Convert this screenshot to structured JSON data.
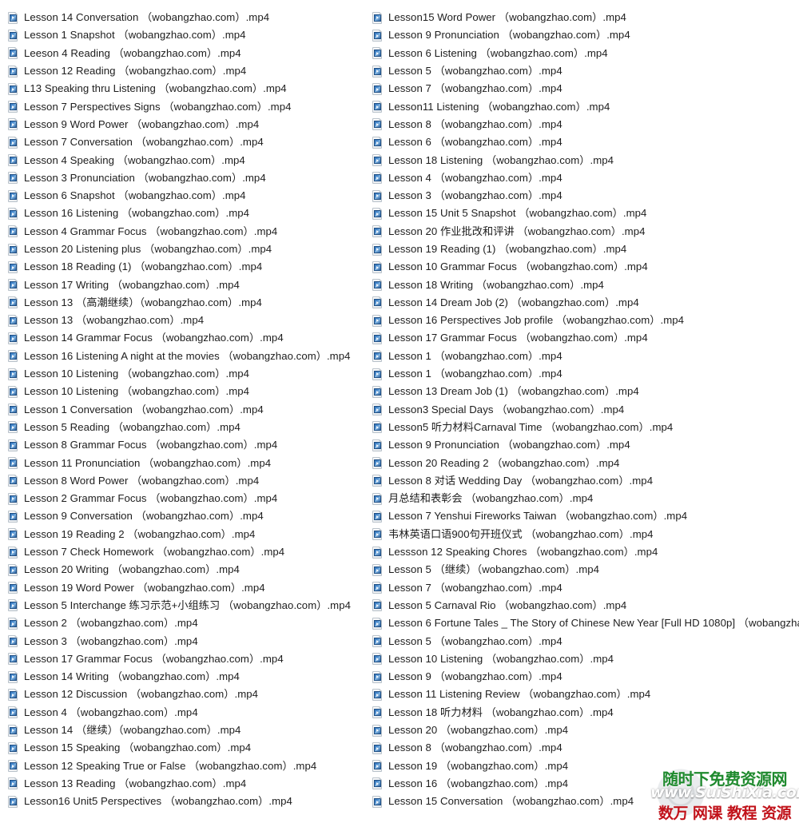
{
  "window": {
    "view": "file-list",
    "icon_type": "mp4-video-file-icon",
    "columns": 2,
    "background_color": "#ffffff",
    "text_color": "#1d1d1d"
  },
  "columns": {
    "left": {
      "files": [
        "Lesson 14 Conversation （wobangzhao.com）.mp4",
        "Lesson 1 Snapshot （wobangzhao.com）.mp4",
        "Leeson 4 Reading （wobangzhao.com）.mp4",
        "Lesson 12 Reading （wobangzhao.com）.mp4",
        "L13 Speaking thru Listening （wobangzhao.com）.mp4",
        "Lesson 7 Perspectives Signs （wobangzhao.com）.mp4",
        "Lesson 9 Word Power （wobangzhao.com）.mp4",
        "Lesson 7 Conversation （wobangzhao.com）.mp4",
        "Lesson 4 Speaking （wobangzhao.com）.mp4",
        "Lesson 3 Pronunciation （wobangzhao.com）.mp4",
        "Lesson 6 Snapshot （wobangzhao.com）.mp4",
        "Lesson 16 Listening （wobangzhao.com）.mp4",
        "Lesson 4 Grammar Focus （wobangzhao.com）.mp4",
        "Lesson 20 Listening plus （wobangzhao.com）.mp4",
        "Lesson 18 Reading (1) （wobangzhao.com）.mp4",
        "Lesson 17 Writing （wobangzhao.com）.mp4",
        "Lesson 13 （高潮继续）（wobangzhao.com）.mp4",
        "Lesson 13 （wobangzhao.com）.mp4",
        "Lesson 14 Grammar Focus （wobangzhao.com）.mp4",
        "Lesson 16 Listening A night at the movies （wobangzhao.com）.mp4",
        "Lesson 10 Listening （wobangzhao.com）.mp4",
        "Lesson 10 Listening （wobangzhao.com）.mp4",
        "Lesson 1 Conversation （wobangzhao.com）.mp4",
        "Lesson 5 Reading （wobangzhao.com）.mp4",
        "Lesson 8 Grammar Focus （wobangzhao.com）.mp4",
        "Lesson 11 Pronunciation （wobangzhao.com）.mp4",
        "Lesson 8 Word Power （wobangzhao.com）.mp4",
        "Lesson 2 Grammar Focus （wobangzhao.com）.mp4",
        "Lesson 9 Conversation （wobangzhao.com）.mp4",
        "Lesson 19 Reading 2 （wobangzhao.com）.mp4",
        "Lesson 7 Check Homework （wobangzhao.com）.mp4",
        "Lesson 20 Writing （wobangzhao.com）.mp4",
        "Lesson 19 Word Power （wobangzhao.com）.mp4",
        "Lesson 5 Interchange 练习示范+小组练习 （wobangzhao.com）.mp4",
        "Lesson 2 （wobangzhao.com）.mp4",
        "Lesson 3 （wobangzhao.com）.mp4",
        "Lesson 17 Grammar Focus （wobangzhao.com）.mp4",
        "Lesson 14 Writing （wobangzhao.com）.mp4",
        "Lesson 12 Discussion （wobangzhao.com）.mp4",
        "Lesson 4 （wobangzhao.com）.mp4",
        "Lesson 14 （继续）（wobangzhao.com）.mp4",
        "Lesson 15 Speaking （wobangzhao.com）.mp4",
        "Lesson 12 Speaking True or False （wobangzhao.com）.mp4",
        "Lesson 13 Reading （wobangzhao.com）.mp4",
        "Lesson16 Unit5 Perspectives （wobangzhao.com）.mp4"
      ]
    },
    "right": {
      "files": [
        "Lesson15 Word Power （wobangzhao.com）.mp4",
        "Lesson 9 Pronunciation （wobangzhao.com）.mp4",
        "Lesson 6 Listening （wobangzhao.com）.mp4",
        "Lesson 5 （wobangzhao.com）.mp4",
        "Lesson 7 （wobangzhao.com）.mp4",
        "Lesson11 Listening （wobangzhao.com）.mp4",
        "Lesson 8 （wobangzhao.com）.mp4",
        "Lesson 6 （wobangzhao.com）.mp4",
        "Lesson 18 Listening （wobangzhao.com）.mp4",
        "Lesson 4 （wobangzhao.com）.mp4",
        "Lesson 3 （wobangzhao.com）.mp4",
        "Lesson 15 Unit 5 Snapshot （wobangzhao.com）.mp4",
        "Lesson 20 作业批改和评讲 （wobangzhao.com）.mp4",
        "Lesson 19 Reading (1) （wobangzhao.com）.mp4",
        "Lesson 10 Grammar Focus （wobangzhao.com）.mp4",
        "Lesson 18 Writing （wobangzhao.com）.mp4",
        "Lesson 14 Dream Job (2) （wobangzhao.com）.mp4",
        "Lesson 16 Perspectives Job profile （wobangzhao.com）.mp4",
        "Lesson 17 Grammar Focus （wobangzhao.com）.mp4",
        "Lesson 1 （wobangzhao.com）.mp4",
        "Lesson 1 （wobangzhao.com）.mp4",
        "Lesson 13 Dream Job (1) （wobangzhao.com）.mp4",
        "Lesson3 Special Days （wobangzhao.com）.mp4",
        "Lesson5 听力材料Carnaval Time （wobangzhao.com）.mp4",
        "Lesson 9 Pronunciation （wobangzhao.com）.mp4",
        "Lesson 20 Reading 2 （wobangzhao.com）.mp4",
        "Lesson 8 对话 Wedding Day （wobangzhao.com）.mp4",
        "月总结和表彰会 （wobangzhao.com）.mp4",
        "Lesson 7 Yenshui Fireworks Taiwan （wobangzhao.com）.mp4",
        "韦林英语口语900句开班仪式 （wobangzhao.com）.mp4",
        "Lessson 12 Speaking Chores （wobangzhao.com）.mp4",
        "Lesson 5 （继续）（wobangzhao.com）.mp4",
        "Lesson 7 （wobangzhao.com）.mp4",
        "Lesson 5 Carnaval Rio （wobangzhao.com）.mp4",
        "Lesson 6 Fortune Tales _ The Story of Chinese New Year [Full HD 1080p] （wobangzha",
        "Lesson 5 （wobangzhao.com）.mp4",
        "Lesson 10 Listening （wobangzhao.com）.mp4",
        "Lesson 9 （wobangzhao.com）.mp4",
        "Lesson 11 Listening Review （wobangzhao.com）.mp4",
        "Lesson 18 听力材料 （wobangzhao.com）.mp4",
        "Lesson 20 （wobangzhao.com）.mp4",
        "Lesson 8 （wobangzhao.com）.mp4",
        "Lesson 19 （wobangzhao.com）.mp4",
        "Lesson 16 （wobangzhao.com）.mp4",
        "Lesson 15 Conversation （wobangzhao.com）.mp4"
      ]
    }
  },
  "watermark": {
    "top_text": "随时下免费资源网",
    "site_text": "www.SuiShiXia.com",
    "bottom_text": "数万 网课 教程 资源",
    "top_color": "#1f8a2e",
    "site_color": "#ffffff",
    "bottom_color": "#c1121a"
  }
}
